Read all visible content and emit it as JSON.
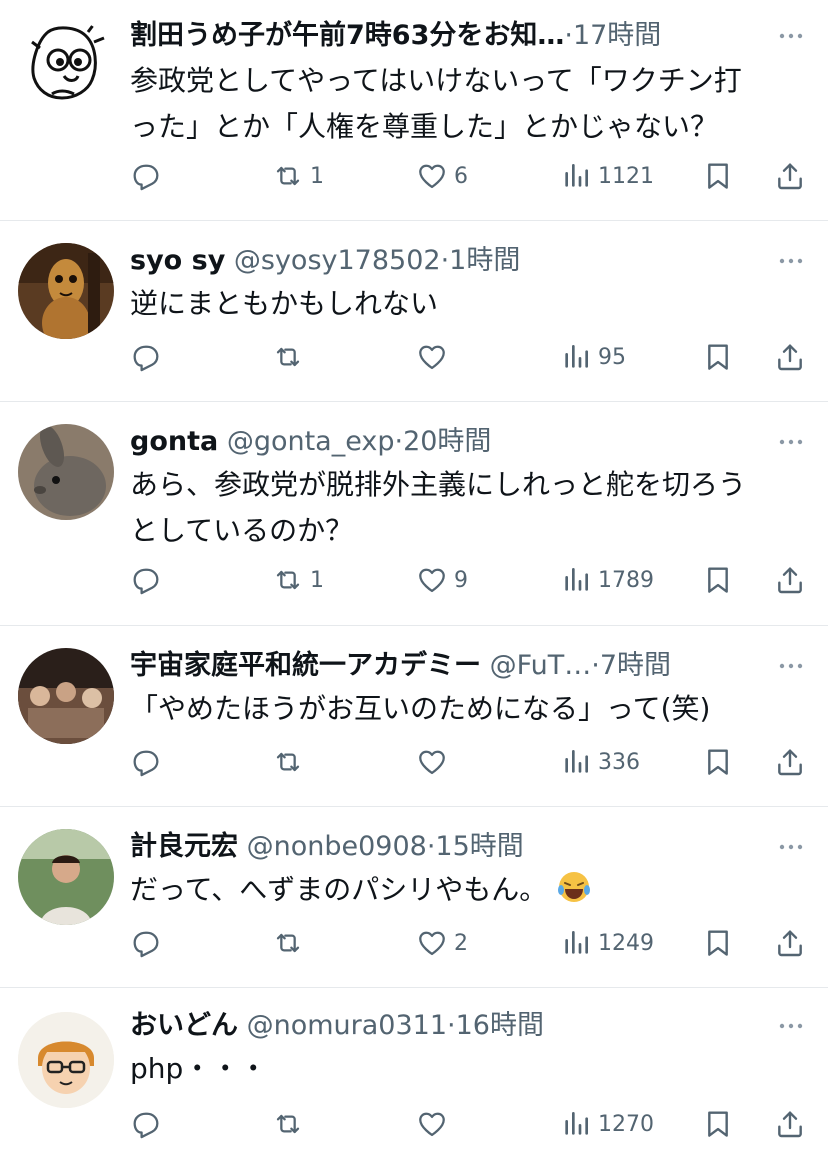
{
  "tweets": [
    {
      "name": "割田うめ子が午前7時63分をお知…",
      "handle": "",
      "time": "·17時間",
      "text_lines": [
        "参政党としてやってはいけないって「ワクチン打",
        "った」とか「人権を尊重した」とかじゃない？"
      ],
      "reply_count": "",
      "retweet_count": "1",
      "like_count": "6",
      "view_count": "1121",
      "avatar": "cartoon-face"
    },
    {
      "name": "syo sy",
      "handle": "@syosy178502",
      "time": "·1時間",
      "text_lines": [
        "逆にまともかもしれない"
      ],
      "reply_count": "",
      "retweet_count": "",
      "like_count": "",
      "view_count": "95",
      "avatar": "wooden-doll"
    },
    {
      "name": "gonta",
      "handle": "@gonta_exp",
      "time": "·20時間",
      "text_lines": [
        "あら、参政党が脱排外主義にしれっと舵を切ろう",
        "としているのか？"
      ],
      "reply_count": "",
      "retweet_count": "1",
      "like_count": "9",
      "view_count": "1789",
      "avatar": "rabbit"
    },
    {
      "name": "宇宙家庭平和統一アカデミー",
      "handle": "@FuT…",
      "time": "·7時間",
      "text_lines": [
        "「やめたほうがお互いのためになる」って(笑)"
      ],
      "reply_count": "",
      "retweet_count": "",
      "like_count": "",
      "view_count": "336",
      "avatar": "group-photo"
    },
    {
      "name": "計良元宏",
      "handle": "@nonbe0908",
      "time": "·15時間",
      "text_lines": [
        "だって、へずまのパシリやもん。"
      ],
      "emoji": "laughing-tears-emoji",
      "reply_count": "",
      "retweet_count": "",
      "like_count": "2",
      "view_count": "1249",
      "avatar": "person-photo"
    },
    {
      "name": "おいどん",
      "handle": "@nomura0311",
      "time": "·16時間",
      "text_lines": [
        "php・・・"
      ],
      "reply_count": "",
      "retweet_count": "",
      "like_count": "",
      "view_count": "1270",
      "avatar": "glasses-cartoon"
    }
  ],
  "colors": {
    "text": "#0f1419",
    "secondary": "#536471",
    "divider": "#e6e9ec"
  },
  "icons": [
    "reply-icon",
    "retweet-icon",
    "like-icon",
    "views-icon",
    "bookmark-icon",
    "share-icon",
    "more-icon"
  ]
}
